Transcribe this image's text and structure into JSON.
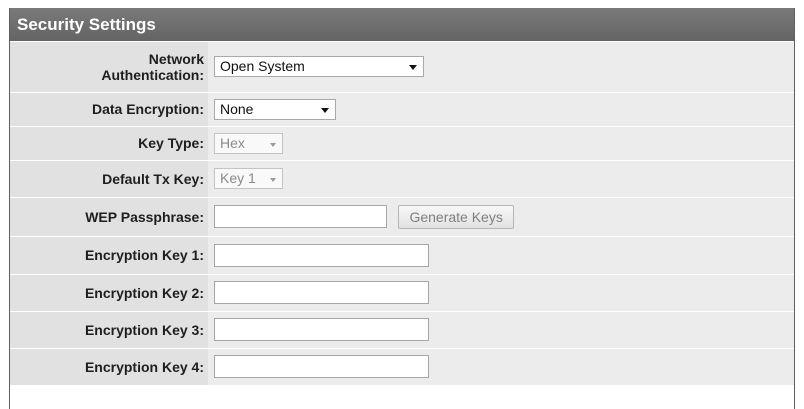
{
  "section": {
    "title": "Security Settings"
  },
  "fields": {
    "network_auth": {
      "label_line1": "Network",
      "label_line2": "Authentication:",
      "value": "Open System"
    },
    "data_encryption": {
      "label": "Data Encryption:",
      "value": "None"
    },
    "key_type": {
      "label": "Key Type:",
      "value": "Hex"
    },
    "default_tx_key": {
      "label": "Default Tx Key:",
      "value": "Key 1"
    },
    "wep_passphrase": {
      "label": "WEP Passphrase:",
      "value": "",
      "button_label": "Generate Keys"
    },
    "encryption_key_1": {
      "label": "Encryption Key 1:",
      "value": ""
    },
    "encryption_key_2": {
      "label": "Encryption Key 2:",
      "value": ""
    },
    "encryption_key_3": {
      "label": "Encryption Key 3:",
      "value": ""
    },
    "encryption_key_4": {
      "label": "Encryption Key 4:",
      "value": ""
    }
  },
  "icons": {
    "dropdown": "chevron-down-icon"
  }
}
